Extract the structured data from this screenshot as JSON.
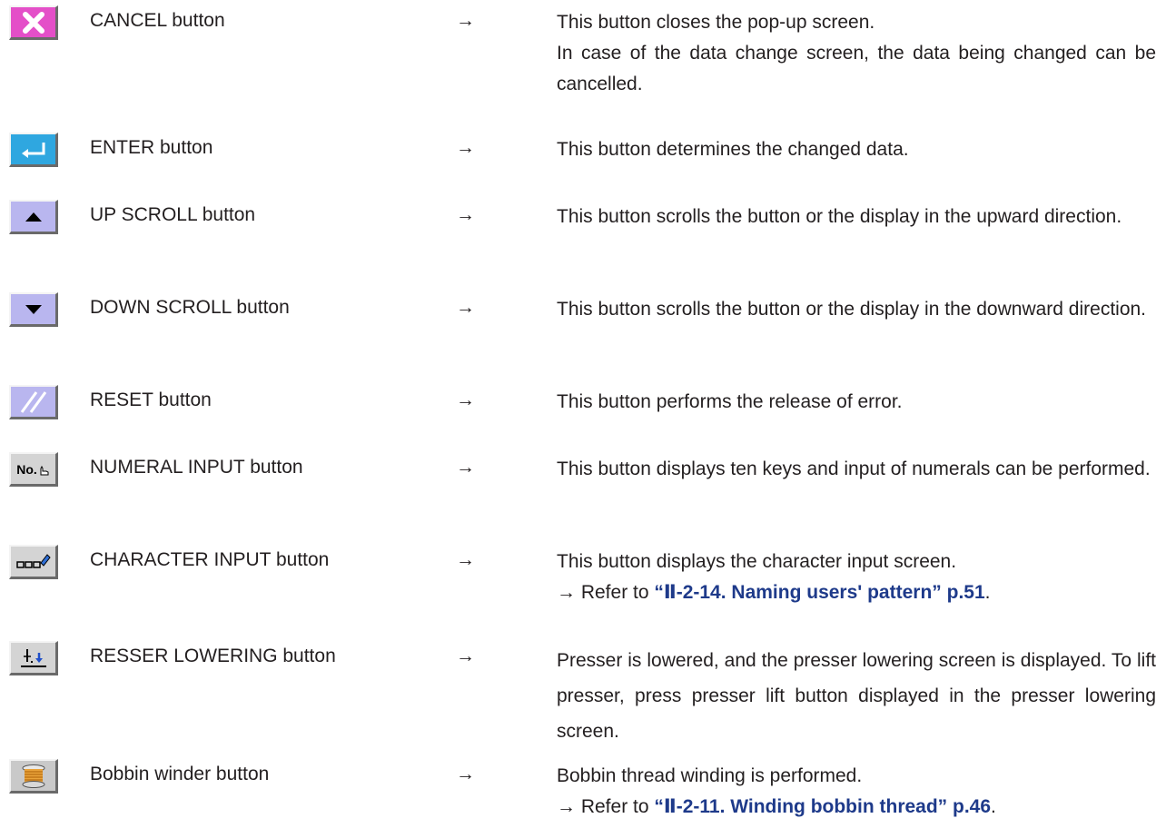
{
  "rows": [
    {
      "icon": "cancel-x-icon",
      "name": "CANCEL button",
      "arrow": "→",
      "lines": [
        "This button closes the pop-up screen.",
        "In case of the data change screen, the data being changed can be cancelled."
      ]
    },
    {
      "icon": "enter-return-icon",
      "name": "ENTER button",
      "arrow": "→",
      "lines": [
        "This button determines the changed data."
      ]
    },
    {
      "icon": "up-triangle-icon",
      "name": "UP SCROLL button",
      "arrow": "→",
      "lines": [
        "This button scrolls the button or the display in the upward direction."
      ]
    },
    {
      "icon": "down-triangle-icon",
      "name": "DOWN SCROLL button",
      "arrow": "→",
      "lines": [
        "This button scrolls the button or the display in the downward direction."
      ]
    },
    {
      "icon": "reset-slash-icon",
      "name": "RESET button",
      "arrow": "→",
      "lines": [
        "This button performs the release of error."
      ]
    },
    {
      "icon": "numeral-input-icon",
      "icon_text": "No.",
      "name": "NUMERAL INPUT button",
      "arrow": "→",
      "lines": [
        "This button displays ten keys and input of numerals can be performed."
      ]
    },
    {
      "icon": "character-input-pencil-icon",
      "name": "CHARACTER INPUT button",
      "arrow": "→",
      "lines": [
        "This button displays the character input screen."
      ],
      "ref_prefix": "→ Refer to ",
      "ref_link": "“Ⅱ-2-14. Naming users' pattern” p.51",
      "ref_suffix": "."
    },
    {
      "icon": "presser-lowering-icon",
      "name": "RESSER LOWERING button",
      "arrow": "→",
      "lines": [
        "Presser is lowered, and the presser lowering screen is displayed. To lift presser, press presser lift button displayed in the presser lowering screen."
      ]
    },
    {
      "icon": "bobbin-winder-icon",
      "name": "Bobbin winder button",
      "arrow": "→",
      "lines": [
        "Bobbin thread winding is performed."
      ],
      "ref_prefix": "→ Refer to ",
      "ref_link": "“Ⅱ-2-11. Winding bobbin thread” p.46",
      "ref_suffix": "."
    }
  ],
  "colors": {
    "cancel_bg": "#e44fc8",
    "enter_bg": "#2fa7e0",
    "scroll_bg": "#b9b6ef",
    "gray_bg": "#c8c8c8",
    "link": "#1e3a8a"
  }
}
